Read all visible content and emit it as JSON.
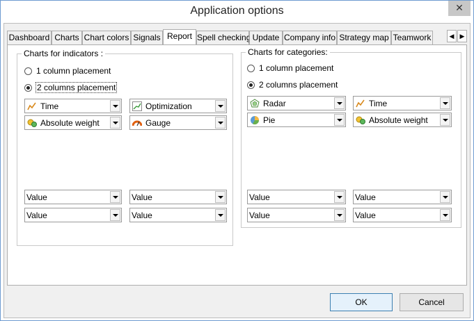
{
  "window": {
    "title": "Application options",
    "close_glyph": "✕"
  },
  "tabs": [
    {
      "label": "Dashboard"
    },
    {
      "label": "Charts"
    },
    {
      "label": "Chart colors"
    },
    {
      "label": "Signals"
    },
    {
      "label": "Report",
      "active": true
    },
    {
      "label": "Spell checking"
    },
    {
      "label": "Update"
    },
    {
      "label": "Company info"
    },
    {
      "label": "Strategy map"
    },
    {
      "label": "Teamwork"
    }
  ],
  "tab_scroll": {
    "left_glyph": "◀",
    "right_glyph": "▶"
  },
  "indicators": {
    "title": "Charts for indicators :",
    "radio_1": "1 column placement",
    "radio_2": "2 columns placement",
    "selected": "2 columns placement",
    "combos": [
      {
        "value": "Time",
        "icon": "line-chart-icon"
      },
      {
        "value": "Optimization",
        "icon": "optimization-chart-icon"
      },
      {
        "value": "Absolute weight",
        "icon": "weight-icon"
      },
      {
        "value": "Gauge",
        "icon": "gauge-icon"
      }
    ],
    "value_combos": [
      "Value",
      "Value",
      "Value",
      "Value"
    ]
  },
  "categories": {
    "title": "Charts for categories:",
    "radio_1": "1 column placement",
    "radio_2": "2 columns placement",
    "selected": "2 columns placement",
    "combos": [
      {
        "value": "Radar",
        "icon": "radar-icon"
      },
      {
        "value": "Time",
        "icon": "line-chart-icon"
      },
      {
        "value": "Pie",
        "icon": "pie-chart-icon"
      },
      {
        "value": "Absolute weight",
        "icon": "weight-icon"
      }
    ],
    "value_combos": [
      "Value",
      "Value",
      "Value",
      "Value"
    ]
  },
  "buttons": {
    "ok": "OK",
    "cancel": "Cancel"
  }
}
